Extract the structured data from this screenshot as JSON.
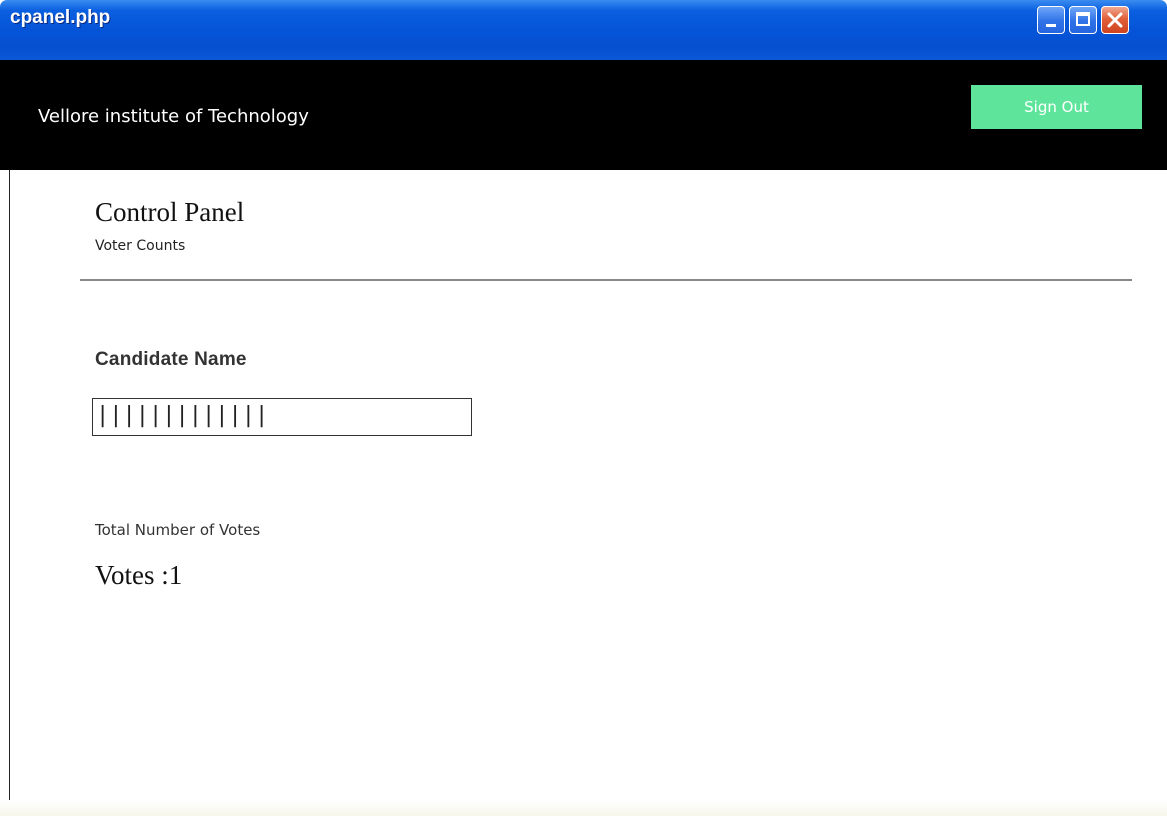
{
  "window": {
    "title": "cpanel.php",
    "controls": {
      "minimize_icon": "minimize-icon",
      "maximize_icon": "maximize-icon",
      "close_icon": "close-icon"
    }
  },
  "header": {
    "brand": "Vellore institute of Technology",
    "signout_label": "Sign Out",
    "colors": {
      "background": "#000000",
      "signout_button": "#5fe59b"
    }
  },
  "main": {
    "title": "Control Panel",
    "subtitle": "Voter Counts",
    "candidate_label": "Candidate Name",
    "candidate_value": "|||||||||||||",
    "votes_caption": "Total Number of Votes",
    "votes_text": "Votes :1"
  },
  "colors": {
    "titlebar": "#0554d8",
    "close_button": "#e0603a"
  }
}
